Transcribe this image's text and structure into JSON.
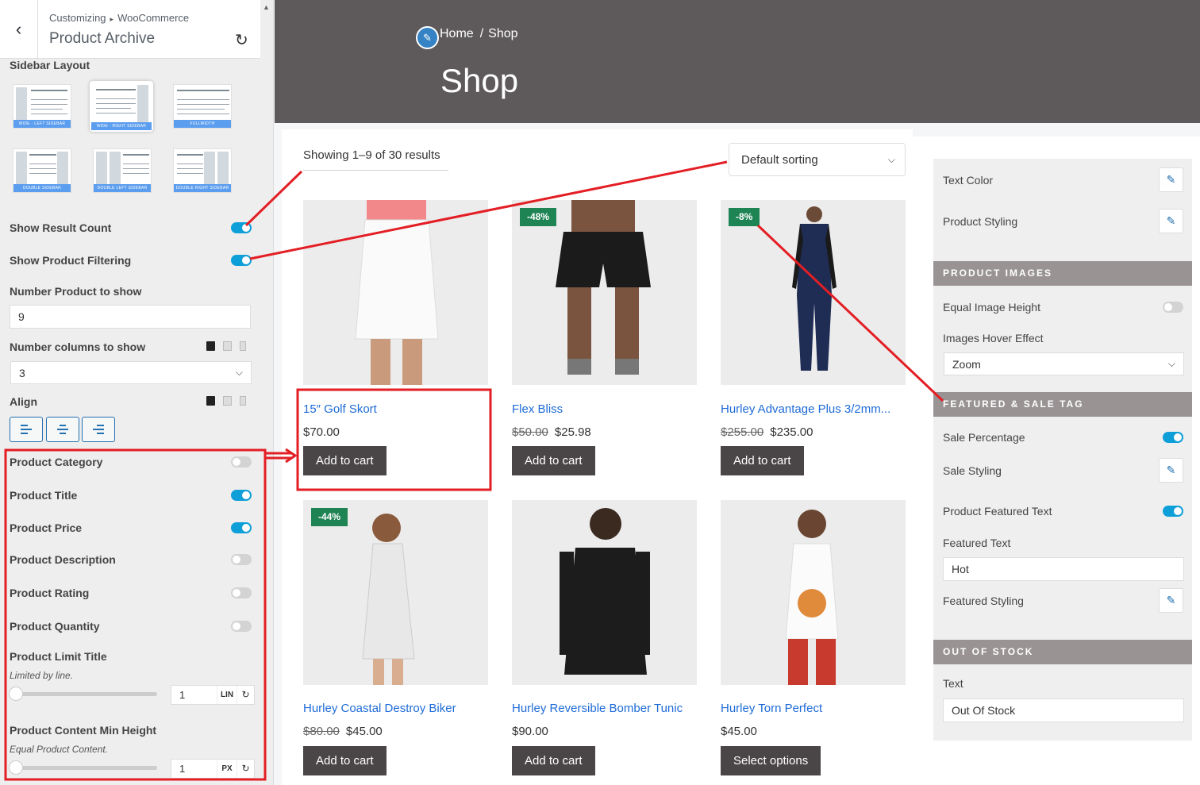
{
  "panel": {
    "breadcrumb_root": "Customizing",
    "breadcrumb_section": "WooCommerce",
    "title": "Product Archive",
    "sidebar_layout_label": "Sidebar Layout",
    "layouts": [
      {
        "label": "WIDE - LEFT SIDEBAR",
        "selected": false
      },
      {
        "label": "WIDE - RIGHT SIDEBAR",
        "selected": true
      },
      {
        "label": "FULLWIDTH",
        "selected": false
      },
      {
        "label": "DOUBLE SIDEBAR",
        "selected": false
      },
      {
        "label": "DOUBLE LEFT SIDEBAR",
        "selected": false
      },
      {
        "label": "DOUBLE RIGHT SIDEBAR",
        "selected": false
      }
    ],
    "show_result_count": {
      "label": "Show Result Count",
      "on": true
    },
    "show_product_filtering": {
      "label": "Show Product Filtering",
      "on": true
    },
    "number_product": {
      "label": "Number Product to show",
      "value": "9"
    },
    "number_columns": {
      "label": "Number columns to show",
      "value": "3"
    },
    "align_label": "Align",
    "toggles": [
      {
        "label": "Product Category",
        "on": false
      },
      {
        "label": "Product Title",
        "on": true
      },
      {
        "label": "Product Price",
        "on": true
      },
      {
        "label": "Product Description",
        "on": false
      },
      {
        "label": "Product Rating",
        "on": false
      },
      {
        "label": "Product Quantity",
        "on": false
      }
    ],
    "limit_title": {
      "label": "Product Limit Title",
      "desc": "Limited by line.",
      "value": "1",
      "unit": "LIN"
    },
    "content_min_height": {
      "label": "Product Content Min Height",
      "desc": "Equal Product Content.",
      "value": "1",
      "unit": "PX"
    }
  },
  "hero": {
    "breadcrumb_home": "Home",
    "breadcrumb_sep": "/",
    "breadcrumb_current": "Shop",
    "title": "Shop"
  },
  "shop": {
    "result_count": "Showing 1–9 of 30 results",
    "sort_selected": "Default sorting",
    "products": [
      {
        "title": "15″ Golf Skort",
        "old_price": "",
        "price": "$70.00",
        "sale": "",
        "button": "Add to cart"
      },
      {
        "title": "Flex Bliss",
        "old_price": "$50.00",
        "price": "$25.98",
        "sale": "-48%",
        "button": "Add to cart"
      },
      {
        "title": "Hurley Advantage Plus 3/2mm...",
        "old_price": "$255.00",
        "price": "$235.00",
        "sale": "-8%",
        "button": "Add to cart"
      },
      {
        "title": "Hurley Coastal Destroy Biker",
        "old_price": "$80.00",
        "price": "$45.00",
        "sale": "-44%",
        "button": "Add to cart"
      },
      {
        "title": "Hurley Reversible Bomber Tunic",
        "old_price": "",
        "price": "$90.00",
        "sale": "",
        "button": "Add to cart"
      },
      {
        "title": "Hurley Torn Perfect",
        "old_price": "",
        "price": "$45.00",
        "sale": "",
        "button": "Select options"
      }
    ]
  },
  "right_panel": {
    "text_color": "Text Color",
    "product_styling": "Product Styling",
    "product_images_head": "PRODUCT IMAGES",
    "equal_image_height": {
      "label": "Equal Image Height",
      "on": false
    },
    "hover_effect": {
      "label": "Images Hover Effect",
      "value": "Zoom"
    },
    "featured_head": "FEATURED & SALE TAG",
    "sale_percentage": {
      "label": "Sale Percentage",
      "on": true
    },
    "sale_styling": "Sale Styling",
    "product_featured_text": {
      "label": "Product Featured Text",
      "on": true
    },
    "featured_text": {
      "label": "Featured Text",
      "value": "Hot"
    },
    "featured_styling": "Featured Styling",
    "out_of_stock_head": "OUT OF STOCK",
    "oos_text": {
      "label": "Text",
      "value": "Out Of Stock"
    }
  },
  "colors": {
    "toggle_on": "#0e9fd8",
    "sale_badge": "#1e8454",
    "button": "#4a4546",
    "link": "#1e6bd6",
    "hero_bg": "#5e5a5b",
    "annotation": "#e31e24"
  }
}
